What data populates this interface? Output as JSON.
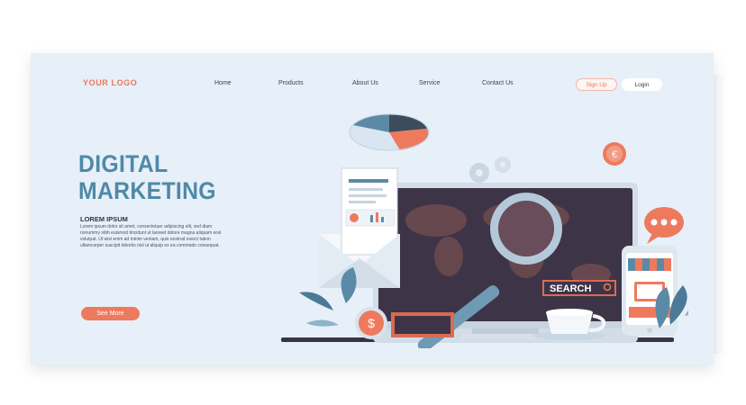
{
  "header": {
    "logo": "YOUR LOGO",
    "nav": [
      "Home",
      "Products",
      "About Us",
      "Service",
      "Contact Us"
    ],
    "signup_label": "Sign Up",
    "login_label": "Login"
  },
  "hero": {
    "title_line1": "DIGITAL",
    "title_line2": "MARKETING",
    "subheading": "LOREM IPSUM",
    "body": "Lorem ipsum dolor sit amet, consectetuer adipiscing elit, sed diam nonummy nibh euismod tincidunt ut laoreet dolore magna aliquam erat volutpat. Ut wisi enim ad minim veniam, quis nostrud exerci tation ullamcorper suscipit lobortis nisl ut aliquip ex ea commodo consequat.",
    "cta_label": "See More"
  },
  "illustration": {
    "search_label": "SEARCH",
    "coin_symbol": "$",
    "euro_symbol": "€"
  },
  "colors": {
    "accent": "#ee7a5e",
    "title": "#4e8aa7",
    "dark": "#2f3643",
    "background": "#e7eff8"
  }
}
